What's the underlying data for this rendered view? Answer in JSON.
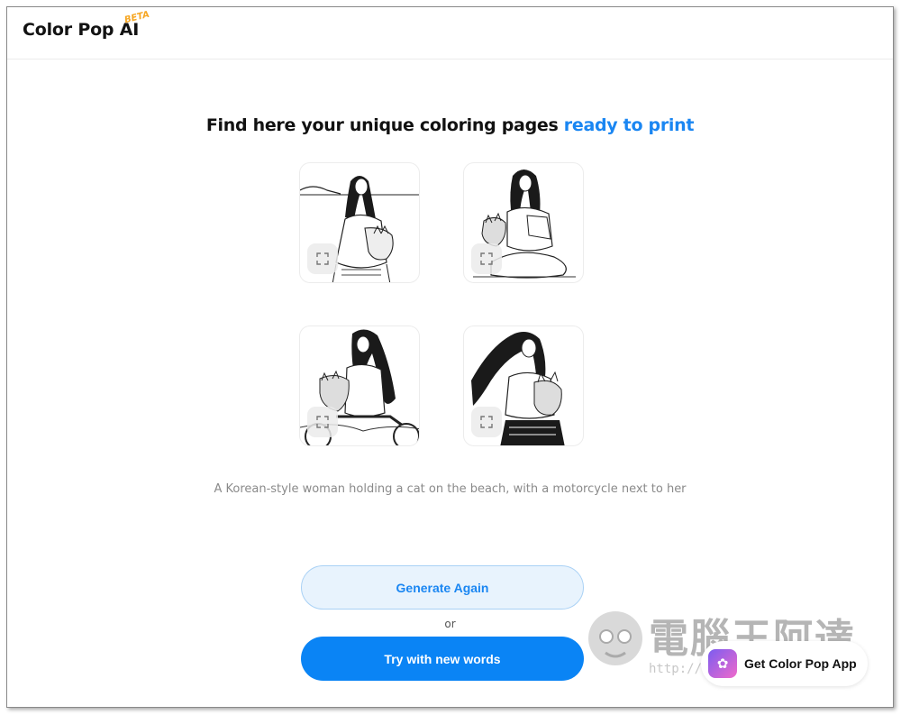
{
  "header": {
    "logo": "Color Pop AI",
    "badge": "BETA"
  },
  "headline": {
    "main": "Find here your unique coloring pages",
    "accent": "ready to print"
  },
  "results": {
    "images": [
      {
        "label": "coloring-page-1"
      },
      {
        "label": "coloring-page-2"
      },
      {
        "label": "coloring-page-3"
      },
      {
        "label": "coloring-page-4"
      }
    ]
  },
  "prompt_text": "A Korean-style woman holding a cat on the beach, with a motorcycle next to her",
  "buttons": {
    "generate_again": "Generate Again",
    "or": "or",
    "try_new_words": "Try with new words"
  },
  "app_chip": {
    "label": "Get Color Pop App"
  },
  "watermark": {
    "title": "電腦王阿達",
    "url": "http://www.kocpc.com.tw"
  },
  "colors": {
    "accent": "#1a86f2",
    "primary_button": "#0a84f5",
    "secondary_button_bg": "#e8f3fd",
    "badge": "#f6a623"
  }
}
